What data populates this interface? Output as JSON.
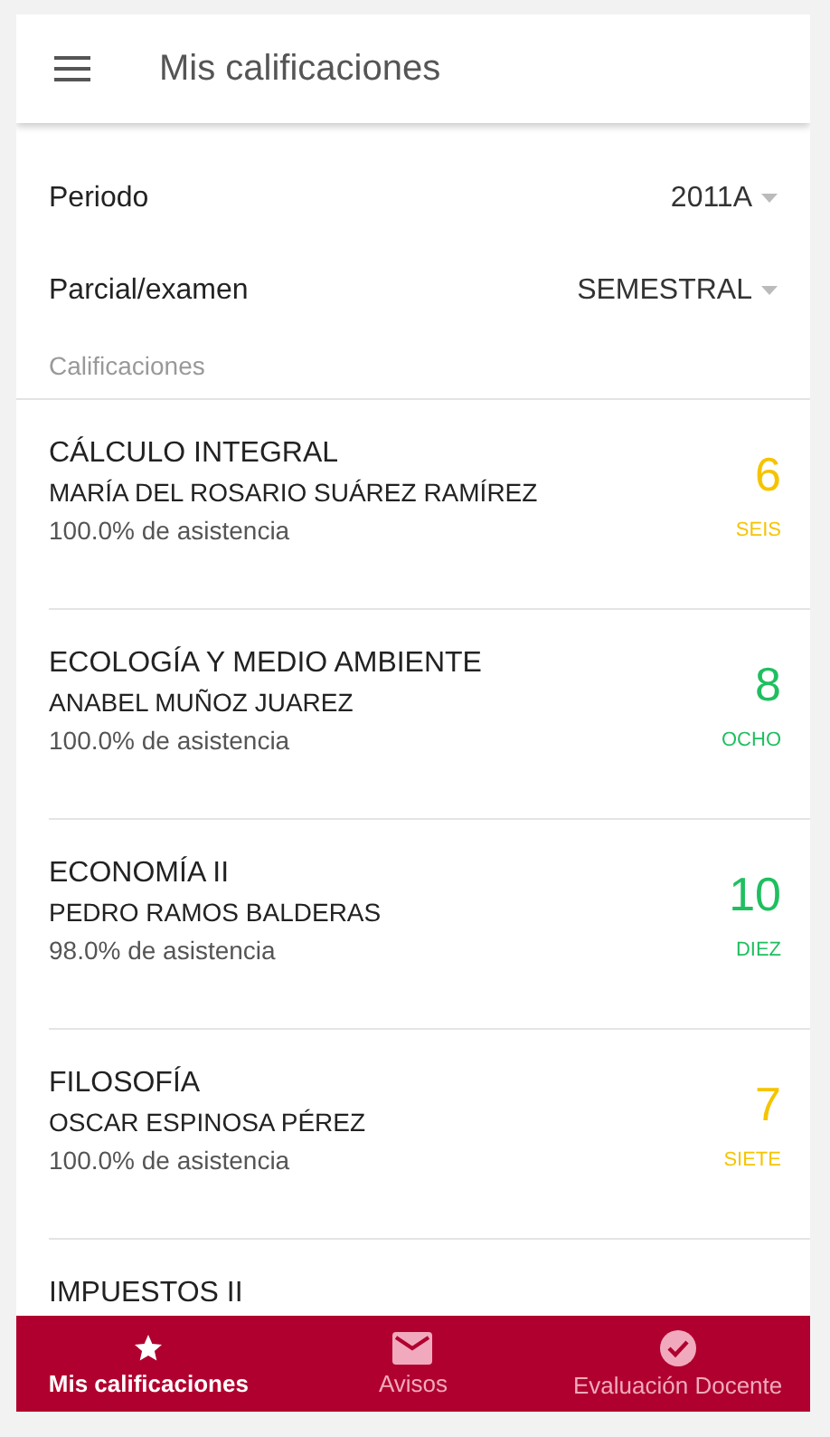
{
  "app_bar": {
    "title": "Mis calificaciones"
  },
  "filters": [
    {
      "label": "Periodo",
      "value": "2011A"
    },
    {
      "label": "Parcial/examen",
      "value": "SEMESTRAL"
    }
  ],
  "section_label": "Calificaciones",
  "grades": [
    {
      "course": "CÁLCULO INTEGRAL",
      "teacher": "MARÍA DEL ROSARIO SUÁREZ RAMÍREZ",
      "attendance": "100.0% de asistencia",
      "grade": "6",
      "grade_word": "SEIS",
      "color": "#f5c400"
    },
    {
      "course": "ECOLOGÍA Y MEDIO AMBIENTE",
      "teacher": "ANABEL MUÑOZ JUAREZ",
      "attendance": "100.0% de asistencia",
      "grade": "8",
      "grade_word": "OCHO",
      "color": "#1fbf5f"
    },
    {
      "course": "ECONOMÍA II",
      "teacher": "PEDRO RAMOS BALDERAS",
      "attendance": "98.0% de asistencia",
      "grade": "10",
      "grade_word": "DIEZ",
      "color": "#1fbf5f"
    },
    {
      "course": "FILOSOFÍA",
      "teacher": "OSCAR ESPINOSA PÉREZ",
      "attendance": "100.0% de asistencia",
      "grade": "7",
      "grade_word": "SIETE",
      "color": "#f5c400"
    },
    {
      "course": "IMPUESTOS II"
    }
  ],
  "bottom_nav": [
    {
      "label": "Mis calificaciones",
      "selected": true
    },
    {
      "label": "Avisos",
      "selected": false
    },
    {
      "label": "Evaluación Docente",
      "selected": false
    }
  ]
}
